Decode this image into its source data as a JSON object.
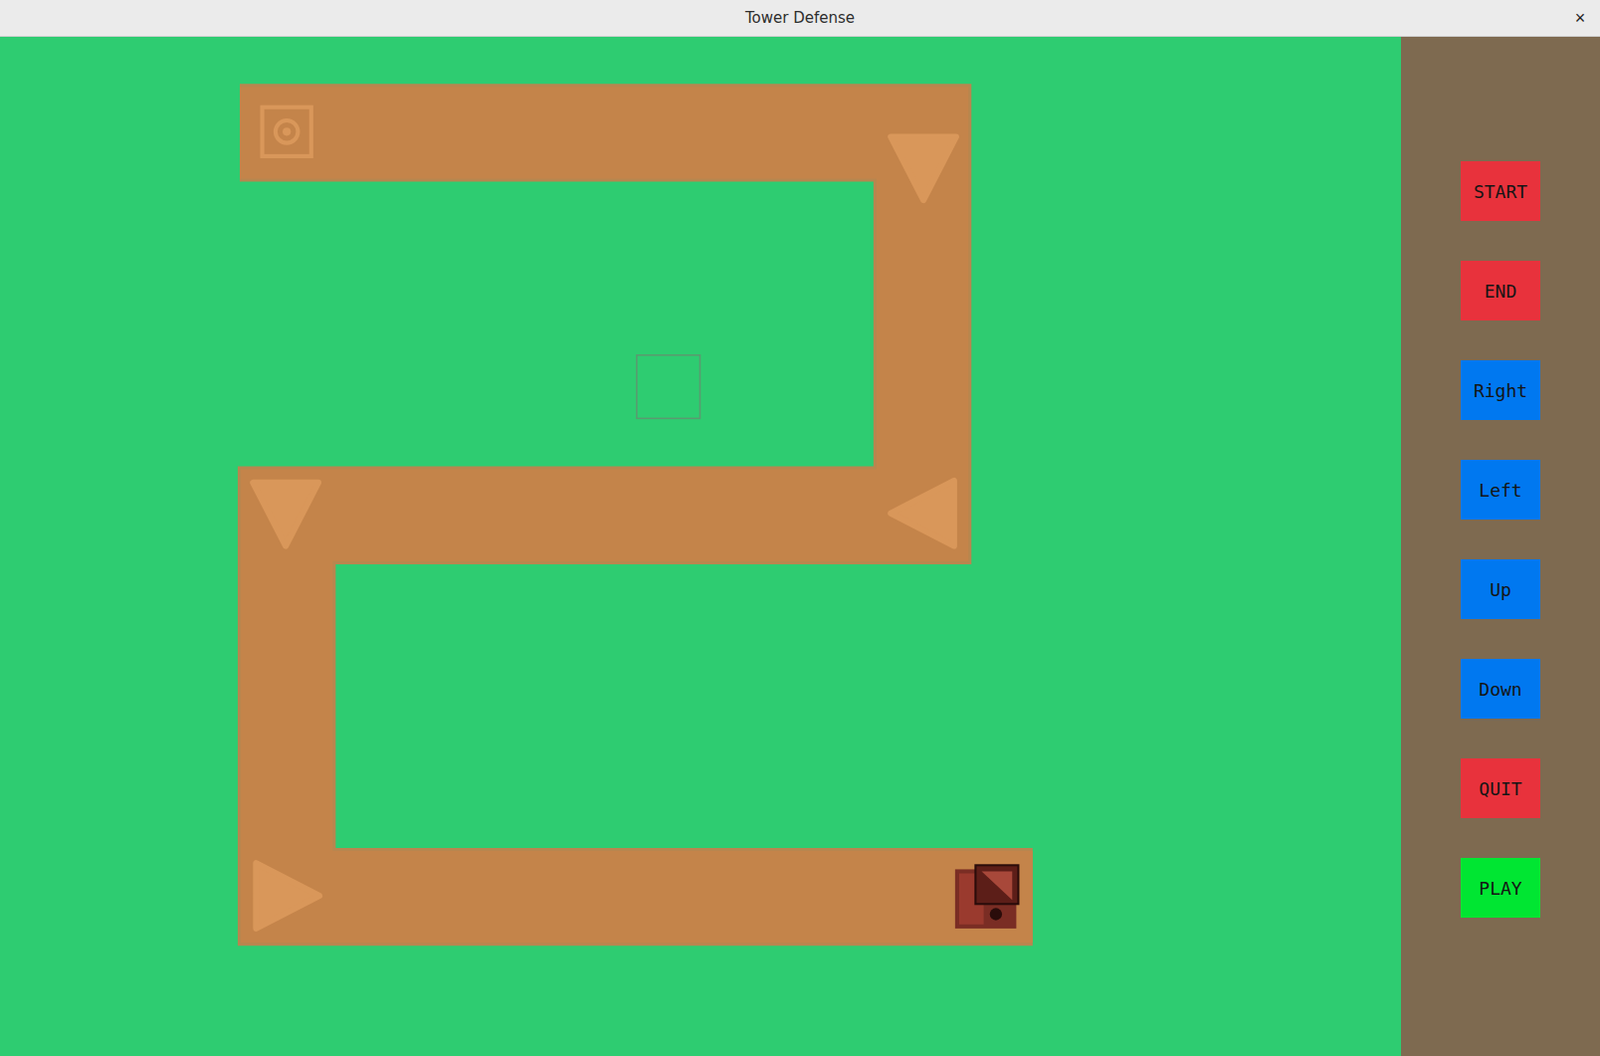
{
  "window": {
    "title": "Tower Defense",
    "close": "×"
  },
  "sidebar": {
    "buttons": [
      {
        "label": "START",
        "color": "#e8323c"
      },
      {
        "label": "END",
        "color": "#e8323c"
      },
      {
        "label": "Right",
        "color": "#0078f0"
      },
      {
        "label": "Left",
        "color": "#0078f0"
      },
      {
        "label": "Up",
        "color": "#0078f0"
      },
      {
        "label": "Down",
        "color": "#0078f0"
      },
      {
        "label": "QUIT",
        "color": "#e8323c"
      },
      {
        "label": "PLAY",
        "color": "#00e632"
      }
    ]
  }
}
